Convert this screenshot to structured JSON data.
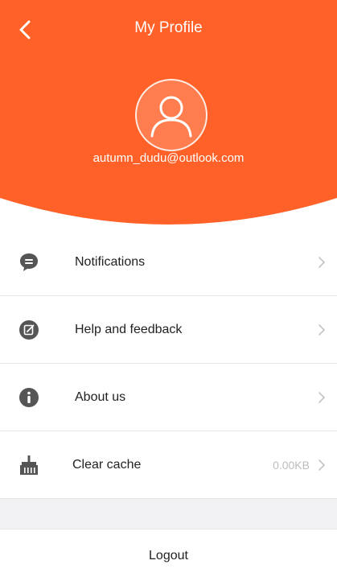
{
  "header": {
    "title": "My Profile",
    "back_icon": "chevron-left-icon",
    "avatar_icon": "user-icon",
    "email": "autumn_dudu@outlook.com",
    "background_color": "#FF6128"
  },
  "menu": {
    "items": [
      {
        "label": "Notifications",
        "icon": "chat-bubble-icon",
        "value": ""
      },
      {
        "label": "Help and feedback",
        "icon": "edit-icon",
        "value": ""
      },
      {
        "label": "About us",
        "icon": "info-icon",
        "value": ""
      },
      {
        "label": "Clear cache",
        "icon": "broom-icon",
        "value": "0.00KB"
      }
    ],
    "chevron_icon": "chevron-right-icon"
  },
  "footer": {
    "logout_label": "Logout"
  },
  "colors": {
    "accent": "#FF6128",
    "icon": "#555555",
    "text": "#222222",
    "muted": "#BDBDBD",
    "divider": "#E6E6E6",
    "section_gap": "#F2F2F4"
  }
}
